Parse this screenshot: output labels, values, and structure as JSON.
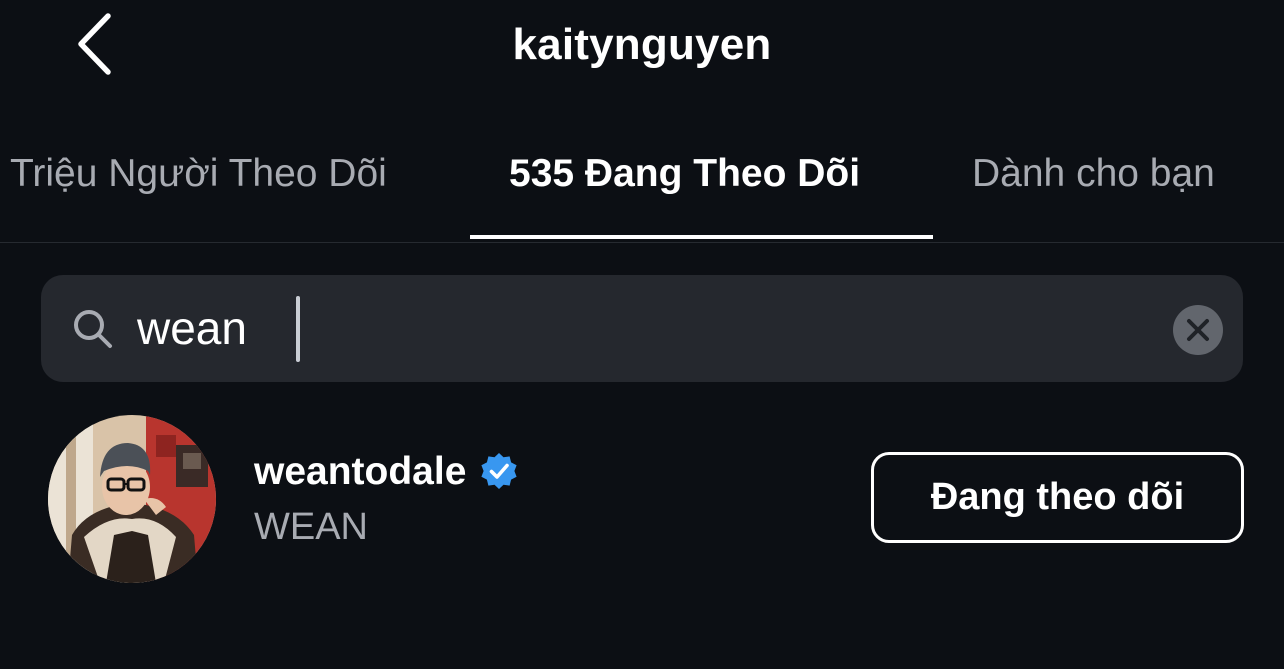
{
  "header": {
    "title": "kaitynguyen",
    "back_icon": "chevron-left-icon"
  },
  "tabs": [
    {
      "label": "Triệu Người Theo Dõi",
      "active": false
    },
    {
      "label": "535 Đang Theo Dõi",
      "active": true
    },
    {
      "label": "Dành cho bạn",
      "active": false
    }
  ],
  "search": {
    "icon": "search-icon",
    "value": "wean",
    "clear_icon": "close-icon"
  },
  "results": [
    {
      "username": "weantodale",
      "verified": true,
      "full_name": "WEAN",
      "button_label": "Đang theo dõi"
    }
  ],
  "colors": {
    "background": "#0c0f14",
    "search_bg": "#25282e",
    "secondary_text": "#a8abb2",
    "verified_badge": "#3897f0"
  }
}
